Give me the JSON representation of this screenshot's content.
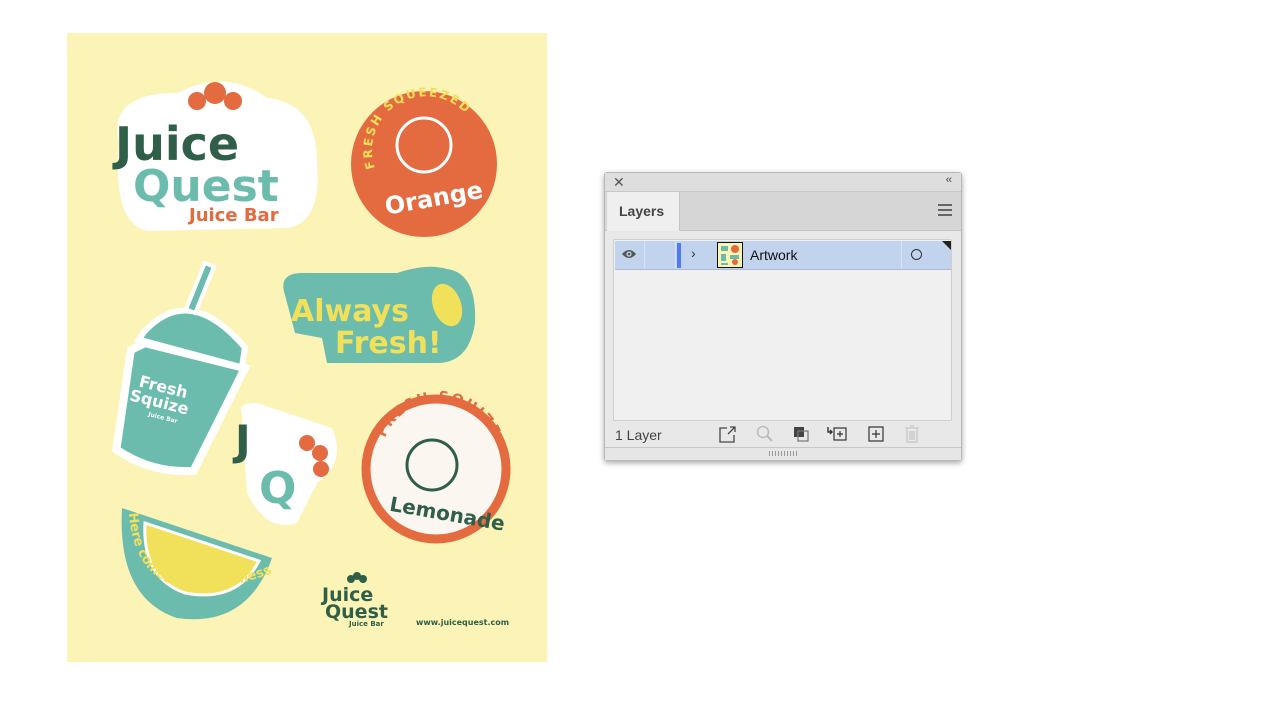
{
  "artboard": {
    "background": "#fbf4b6",
    "stickers": {
      "logo": {
        "line1": "Juice",
        "line2": "Quest",
        "line3": "Juice Bar"
      },
      "orange_badge": {
        "arc": "FRESH SQUEEZED",
        "label": "Orange"
      },
      "cup": {
        "line1": "Fresh",
        "line2": "Squize",
        "line3": "Juice Bar"
      },
      "always_fresh": {
        "line1": "Always",
        "line2": "Fresh!"
      },
      "monogram": {
        "j": "J",
        "q": "Q"
      },
      "lemonade_badge": {
        "arc": "FRESH SQUIZE",
        "label": "Lemonade"
      },
      "lemon_slice": {
        "arc": "Here comes the freshness!"
      },
      "small_logo": {
        "line1": "Juice",
        "line2": "Quest",
        "line3": "Juice Bar"
      },
      "website": "www.juicequest.com"
    },
    "colors": {
      "dark_green": "#2f5e49",
      "teal": "#6cbcae",
      "orange": "#e46a3f",
      "yellow": "#f1e05a"
    }
  },
  "layers_panel": {
    "close_icon": "close-icon",
    "collapse_label": "‹‹",
    "tab_label": "Layers",
    "layers": [
      {
        "name": "Artwork",
        "visible": true,
        "selected": true,
        "color": "#4f7cf6"
      }
    ],
    "footer": {
      "count_label": "1 Layer",
      "icons": [
        "export-icon",
        "search-icon",
        "clipping-mask-icon",
        "new-sublayer-icon",
        "new-layer-icon",
        "trash-icon"
      ]
    }
  }
}
